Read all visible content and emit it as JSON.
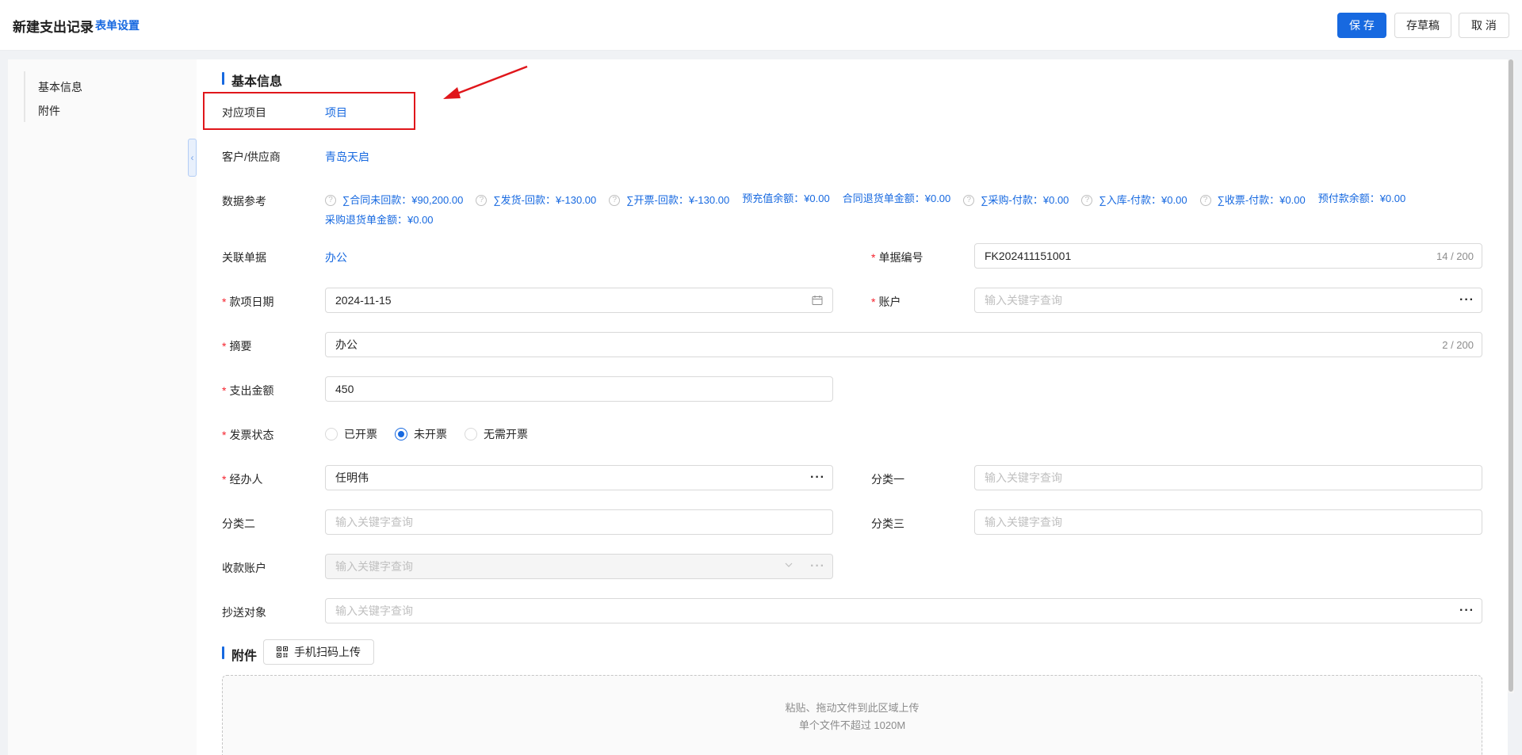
{
  "header": {
    "title": "新建支出记录",
    "settings_link": "表单设置",
    "save_label": "保 存",
    "draft_label": "存草稿",
    "cancel_label": "取 消"
  },
  "sidebar": {
    "items": [
      {
        "label": "基本信息"
      },
      {
        "label": "附件"
      }
    ]
  },
  "basic": {
    "section_title": "基本信息",
    "project": {
      "label": "对应项目",
      "value": "项目"
    },
    "customer": {
      "label": "客户/供应商",
      "value": "青岛天启"
    },
    "data_ref": {
      "label": "数据参考",
      "items": [
        {
          "text": "∑合同未回款：¥90,200.00",
          "help": true
        },
        {
          "text": "∑发货-回款：¥-130.00",
          "help": true
        },
        {
          "text": "∑开票-回款：¥-130.00",
          "help": true
        },
        {
          "text": "预充值余额：¥0.00",
          "help": false
        },
        {
          "text": "合同退货单金额：¥0.00",
          "help": false
        },
        {
          "text": "∑采购-付款：¥0.00",
          "help": true
        },
        {
          "text": "∑入库-付款：¥0.00",
          "help": true
        },
        {
          "text": "∑收票-付款：¥0.00",
          "help": true
        },
        {
          "text": "预付款余额：¥0.00",
          "help": false
        },
        {
          "text": "采购退货单金额：¥0.00",
          "help": false
        }
      ]
    },
    "related_doc": {
      "label": "关联单据",
      "value": "办公"
    },
    "doc_no": {
      "label": "单据编号",
      "value": "FK202411151001",
      "counter": "14 / 200"
    },
    "date": {
      "label": "款项日期",
      "value": "2024-11-15"
    },
    "account": {
      "label": "账户",
      "placeholder": "输入关键字查询"
    },
    "summary": {
      "label": "摘要",
      "value": "办公",
      "counter": "2 / 200"
    },
    "amount": {
      "label": "支出金额",
      "value": "450"
    },
    "invoice": {
      "label": "发票状态",
      "options": [
        "已开票",
        "未开票",
        "无需开票"
      ],
      "selected": "未开票"
    },
    "handler": {
      "label": "经办人",
      "value": "任明伟"
    },
    "cat1": {
      "label": "分类一",
      "placeholder": "输入关键字查询"
    },
    "cat2": {
      "label": "分类二",
      "placeholder": "输入关键字查询"
    },
    "cat3": {
      "label": "分类三",
      "placeholder": "输入关键字查询"
    },
    "recv_account": {
      "label": "收款账户",
      "placeholder": "输入关键字查询"
    },
    "cc": {
      "label": "抄送对象",
      "placeholder": "输入关键字查询"
    }
  },
  "attach": {
    "section_title": "附件",
    "qr_label": "手机扫码上传",
    "upload_line1": "粘贴、拖动文件到此区域上传",
    "upload_line2": "单个文件不超过 1020M"
  },
  "colors": {
    "primary": "#1769e0",
    "required": "#f5222d",
    "annotation": "#e0161b"
  }
}
